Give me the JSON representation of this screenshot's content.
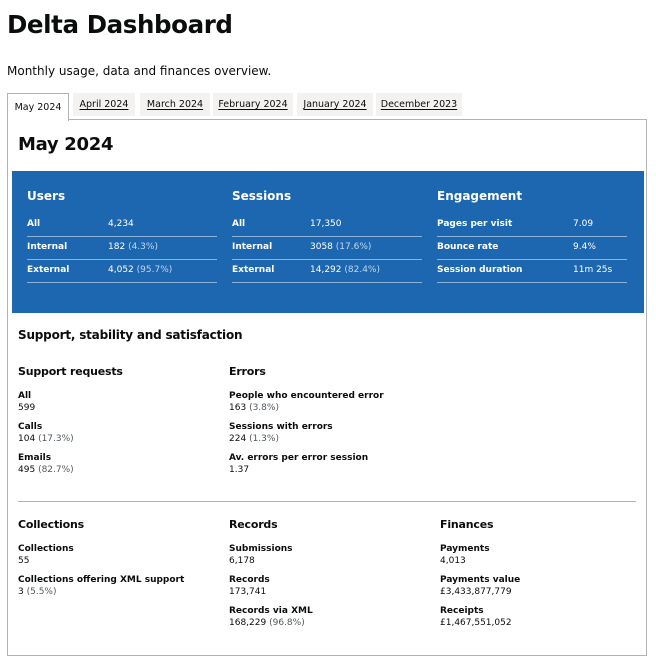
{
  "header": {
    "title": "Delta Dashboard",
    "subtitle": "Monthly usage, data and finances overview."
  },
  "tabs": [
    {
      "label": "May 2024",
      "active": true
    },
    {
      "label": "April 2024",
      "active": false
    },
    {
      "label": "March 2024",
      "active": false
    },
    {
      "label": "February 2024",
      "active": false
    },
    {
      "label": "January 2024",
      "active": false
    },
    {
      "label": "December 2023",
      "active": false
    }
  ],
  "panel": {
    "title": "May 2024",
    "summary": {
      "users": {
        "heading": "Users",
        "rows": [
          {
            "label": "All",
            "value": "4,234",
            "pct": ""
          },
          {
            "label": "Internal",
            "value": "182",
            "pct": "(4.3%)"
          },
          {
            "label": "External",
            "value": "4,052",
            "pct": "(95.7%)"
          }
        ]
      },
      "sessions": {
        "heading": "Sessions",
        "rows": [
          {
            "label": "All",
            "value": "17,350",
            "pct": ""
          },
          {
            "label": "Internal",
            "value": "3058",
            "pct": "(17.6%)"
          },
          {
            "label": "External",
            "value": "14,292",
            "pct": "(82.4%)"
          }
        ]
      },
      "engagement": {
        "heading": "Engagement",
        "rows": [
          {
            "label": "Pages per visit",
            "value": "7.09",
            "pct": ""
          },
          {
            "label": "Bounce rate",
            "value": "9.4%",
            "pct": ""
          },
          {
            "label": "Session duration",
            "value": "11m 25s",
            "pct": ""
          }
        ]
      }
    },
    "support_heading": "Support, stability and satisfaction",
    "support_requests": {
      "heading": "Support requests",
      "stats": [
        {
          "label": "All",
          "value": "599",
          "pct": ""
        },
        {
          "label": "Calls",
          "value": "104",
          "pct": "(17.3%)"
        },
        {
          "label": "Emails",
          "value": "495",
          "pct": "(82.7%)"
        }
      ]
    },
    "errors": {
      "heading": "Errors",
      "stats": [
        {
          "label": "People who encountered error",
          "value": "163",
          "pct": "(3.8%)"
        },
        {
          "label": "Sessions with errors",
          "value": "224",
          "pct": "(1.3%)"
        },
        {
          "label": "Av. errors per error session",
          "value": "1.37",
          "pct": ""
        }
      ]
    },
    "collections": {
      "heading": "Collections",
      "stats": [
        {
          "label": "Collections",
          "value": "55",
          "pct": ""
        },
        {
          "label": "Collections offering XML support",
          "value": "3",
          "pct": "(5.5%)"
        }
      ]
    },
    "records": {
      "heading": "Records",
      "stats": [
        {
          "label": "Submissions",
          "value": "6,178",
          "pct": ""
        },
        {
          "label": "Records",
          "value": "173,741",
          "pct": ""
        },
        {
          "label": "Records via XML",
          "value": "168,229",
          "pct": "(96.8%)"
        }
      ]
    },
    "finances": {
      "heading": "Finances",
      "stats": [
        {
          "label": "Payments",
          "value": "4,013",
          "pct": ""
        },
        {
          "label": "Payments value",
          "value": "£3,433,877,779",
          "pct": ""
        },
        {
          "label": "Receipts",
          "value": "£1,467,551,052",
          "pct": ""
        }
      ]
    }
  },
  "colors": {
    "band": "#1d67b1",
    "text": "#0b0c0c",
    "tab_inactive_bg": "#f3f2f1",
    "border": "#b1b4b6"
  }
}
